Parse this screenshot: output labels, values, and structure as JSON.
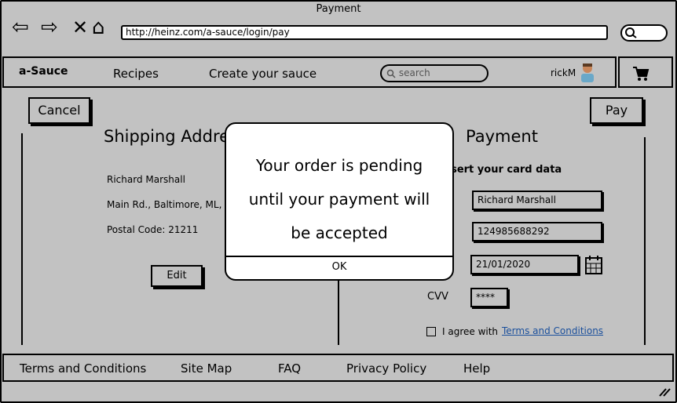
{
  "window": {
    "title": "Payment"
  },
  "browser": {
    "url": "http://heinz.com/a-sauce/login/pay"
  },
  "icons": {
    "back": "back-arrow-icon",
    "forward": "forward-arrow-icon",
    "stop": "close-icon",
    "home": "home-icon",
    "search": "search-icon",
    "cart": "cart-icon",
    "avatar": "avatar-icon",
    "calendar": "calendar-icon",
    "resize": "resize-grip-icon"
  },
  "nav": {
    "logo": "a-Sauce",
    "items": [
      "Recipes",
      "Create your sauce"
    ],
    "search_placeholder": "search",
    "user": "rickM"
  },
  "actions": {
    "cancel": "Cancel",
    "pay": "Pay",
    "edit": "Edit"
  },
  "shipping": {
    "title": "Shipping Address",
    "name": "Richard Marshall",
    "address": "Main Rd., Baltimore, ML, USA",
    "postal": "Postal Code: 21211"
  },
  "payment": {
    "title": "Payment",
    "instruction": "Insert your card data",
    "name_value": "Richard Marshall",
    "card_value": "124985688292",
    "date_value": "21/01/2020",
    "cvv_label": "CVV",
    "cvv_value": "****",
    "agree_text": "I agree with",
    "terms_link": "Terms and Conditions"
  },
  "footer": {
    "items": [
      "Terms and Conditions",
      "Site Map",
      "FAQ",
      "Privacy Policy",
      "Help"
    ]
  },
  "modal": {
    "line1": "Your order is pending",
    "line2": "until your payment will",
    "line3": "be accepted",
    "ok": "OK"
  }
}
